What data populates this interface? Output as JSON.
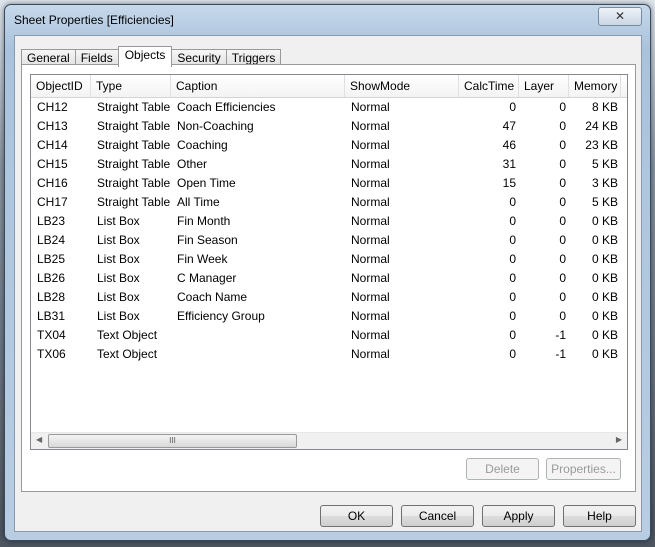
{
  "window": {
    "title": "Sheet Properties [Efficiencies]",
    "close_icon": "close-x-icon"
  },
  "tabs": [
    {
      "label": "General"
    },
    {
      "label": "Fields"
    },
    {
      "label": "Objects",
      "active": true
    },
    {
      "label": "Security"
    },
    {
      "label": "Triggers"
    }
  ],
  "table": {
    "columns": [
      "ObjectID",
      "Type",
      "Caption",
      "ShowMode",
      "CalcTime",
      "Layer",
      "Memory"
    ],
    "rows": [
      [
        "CH12",
        "Straight Table",
        "Coach Efficiencies",
        "Normal",
        "0",
        "0",
        "8 KB"
      ],
      [
        "CH13",
        "Straight Table",
        "Non-Coaching",
        "Normal",
        "47",
        "0",
        "24 KB"
      ],
      [
        "CH14",
        "Straight Table",
        "Coaching",
        "Normal",
        "46",
        "0",
        "23 KB"
      ],
      [
        "CH15",
        "Straight Table",
        "Other",
        "Normal",
        "31",
        "0",
        "5 KB"
      ],
      [
        "CH16",
        "Straight Table",
        "Open Time",
        "Normal",
        "15",
        "0",
        "3 KB"
      ],
      [
        "CH17",
        "Straight Table",
        "All Time",
        "Normal",
        "0",
        "0",
        "5 KB"
      ],
      [
        "LB23",
        "List Box",
        "Fin Month",
        "Normal",
        "0",
        "0",
        "0 KB"
      ],
      [
        "LB24",
        "List Box",
        "Fin Season",
        "Normal",
        "0",
        "0",
        "0 KB"
      ],
      [
        "LB25",
        "List Box",
        "Fin Week",
        "Normal",
        "0",
        "0",
        "0 KB"
      ],
      [
        "LB26",
        "List Box",
        "C Manager",
        "Normal",
        "0",
        "0",
        "0 KB"
      ],
      [
        "LB28",
        "List Box",
        "Coach Name",
        "Normal",
        "0",
        "0",
        "0 KB"
      ],
      [
        "LB31",
        "List Box",
        "Efficiency Group",
        "Normal",
        "0",
        "0",
        "0 KB"
      ],
      [
        "TX04",
        "Text Object",
        "",
        "Normal",
        "0",
        "-1",
        "0 KB"
      ],
      [
        "TX06",
        "Text Object",
        "",
        "Normal",
        "0",
        "-1",
        "0 KB"
      ]
    ],
    "scroll_grip": "III"
  },
  "buttons": {
    "delete": "Delete",
    "properties": "Properties...",
    "ok": "OK",
    "cancel": "Cancel",
    "apply": "Apply",
    "help": "Help"
  }
}
